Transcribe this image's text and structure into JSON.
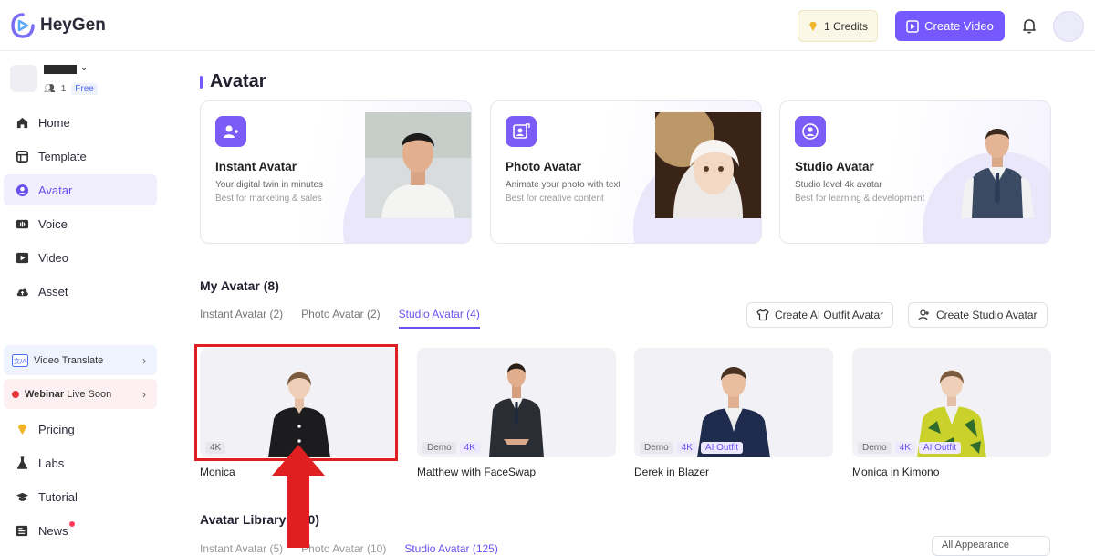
{
  "app": {
    "logo_text": "HeyGen"
  },
  "header": {
    "credits": "1 Credits",
    "create_video": "Create Video"
  },
  "workspace": {
    "members": "1",
    "plan": "Free"
  },
  "sidebar": {
    "nav": [
      {
        "label": "Home",
        "icon": "home-icon"
      },
      {
        "label": "Template",
        "icon": "template-icon"
      },
      {
        "label": "Avatar",
        "icon": "avatar-icon",
        "active": true
      },
      {
        "label": "Voice",
        "icon": "voice-icon"
      },
      {
        "label": "Video",
        "icon": "video-icon"
      },
      {
        "label": "Asset",
        "icon": "cloud-icon"
      }
    ],
    "video_translate": "Video Translate",
    "webinar_bold": "Webinar",
    "webinar_rest": " Live Soon",
    "bottom_nav": [
      {
        "label": "Pricing",
        "icon": "diamond-icon"
      },
      {
        "label": "Labs",
        "icon": "flask-icon"
      },
      {
        "label": "Tutorial",
        "icon": "graduation-cap-icon"
      },
      {
        "label": "News",
        "icon": "news-icon"
      }
    ]
  },
  "main": {
    "title": "Avatar",
    "type_cards": [
      {
        "title": "Instant Avatar",
        "desc1": "Your digital twin in minutes",
        "desc2": "Best for marketing & sales"
      },
      {
        "title": "Photo Avatar",
        "desc1": "Animate your photo with text",
        "desc2": "Best for creative content"
      },
      {
        "title": "Studio Avatar",
        "desc1": "Studio level 4k avatar",
        "desc2": "Best for learning & development"
      }
    ],
    "my_avatar": {
      "title": "My Avatar (8)",
      "tabs": [
        "Instant Avatar (2)",
        "Photo Avatar (2)",
        "Studio Avatar (4)"
      ],
      "active_tab": 2,
      "create_outfit": "Create AI Outfit Avatar",
      "create_studio": "Create Studio Avatar",
      "avatars": [
        {
          "name": "Monica",
          "tags": [
            "4K"
          ]
        },
        {
          "name": "Matthew with FaceSwap",
          "tags": [
            "Demo",
            "4K"
          ]
        },
        {
          "name": "Derek in Blazer",
          "tags": [
            "Demo",
            "4K",
            "AI Outfit"
          ]
        },
        {
          "name": "Monica in Kimono",
          "tags": [
            "Demo",
            "4K",
            "AI Outfit"
          ]
        }
      ]
    },
    "library": {
      "title": "Avatar Library (140)",
      "tabs": [
        "Instant Avatar (5)",
        "Photo Avatar (10)",
        "Studio Avatar (125)"
      ],
      "filter": "All Appearance"
    }
  },
  "colors": {
    "accent": "#7559ff",
    "highlight": "#e02020"
  }
}
